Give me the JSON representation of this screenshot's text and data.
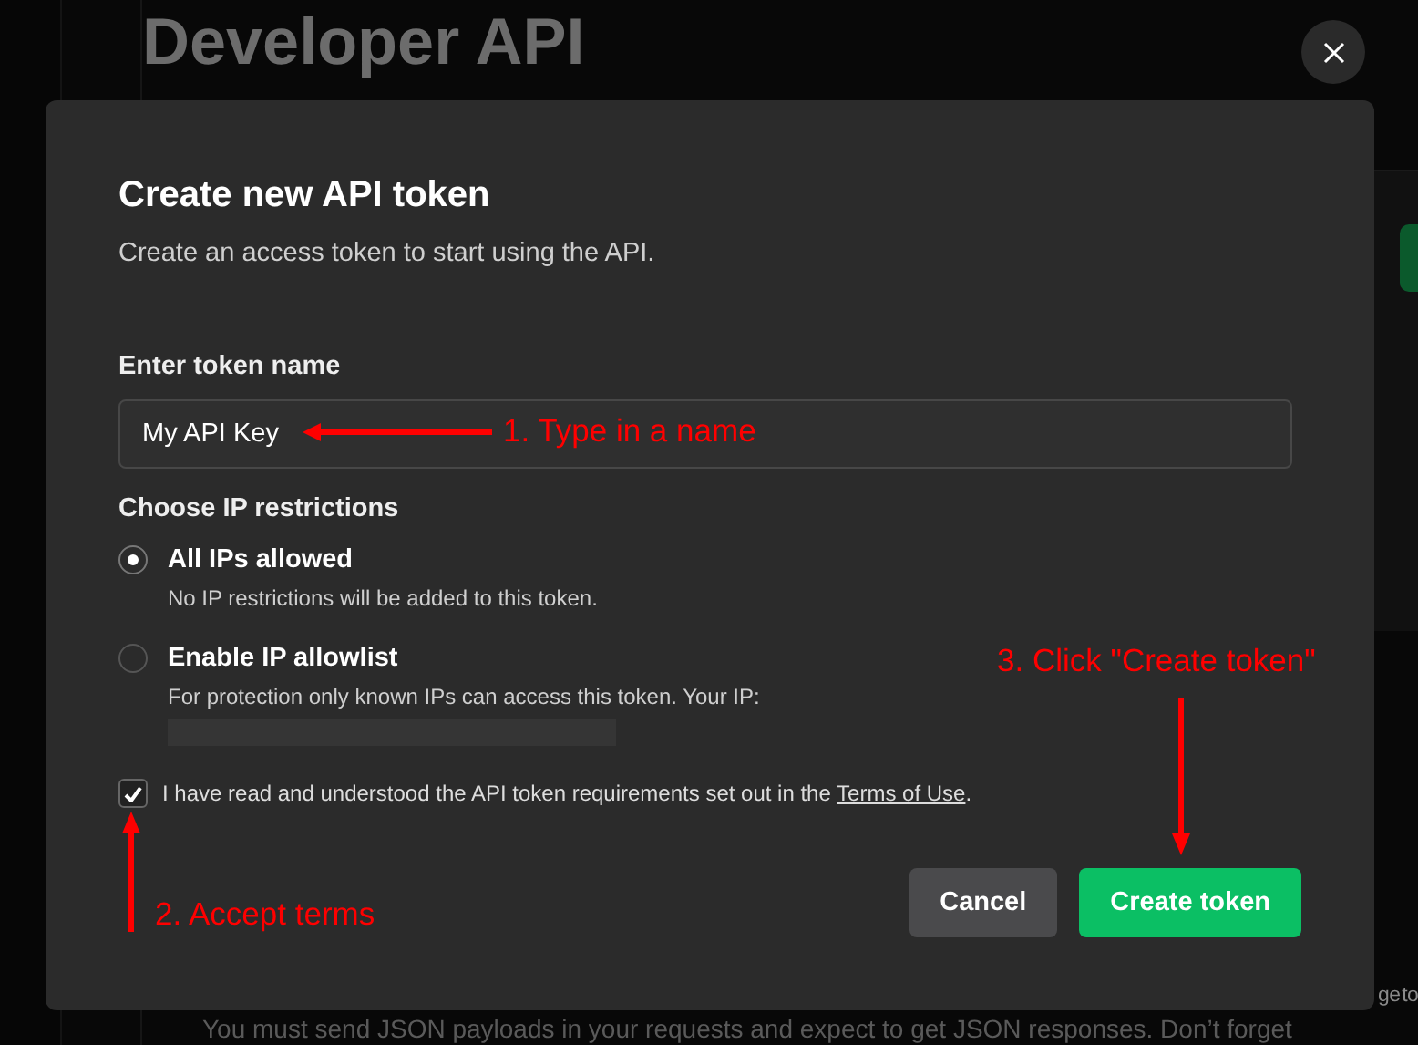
{
  "background": {
    "title": "Developer API",
    "text_fragment": "ge to",
    "paragraph": "You must send JSON payloads in your requests and expect to get JSON responses. Don’t forget"
  },
  "dialog": {
    "title": "Create new API token",
    "subtitle": "Create an access token to start using the API.",
    "name_field": {
      "label": "Enter token name",
      "value": "My API Key"
    },
    "ip_section": {
      "label": "Choose IP restrictions",
      "options": [
        {
          "label": "All IPs allowed",
          "description": "No IP restrictions will be added to this token.",
          "selected": true,
          "redacted_ip": false
        },
        {
          "label": "Enable IP allowlist",
          "description": "For protection only known IPs can access this token. Your IP:",
          "selected": false,
          "redacted_ip": true
        }
      ]
    },
    "terms": {
      "checked": true,
      "text": "I have read and understood the API token requirements set out in the ",
      "link": "Terms of Use",
      "end": "."
    },
    "buttons": [
      {
        "label": "Cancel",
        "kind": "secondary"
      },
      {
        "label": "Create token",
        "kind": "primary"
      }
    ]
  },
  "annotations": [
    {
      "text": "1. Type in a name",
      "kind": "left"
    },
    {
      "text": "3. Click \"Create token\"",
      "kind": "down"
    },
    {
      "text": "2. Accept terms",
      "kind": "up"
    }
  ]
}
